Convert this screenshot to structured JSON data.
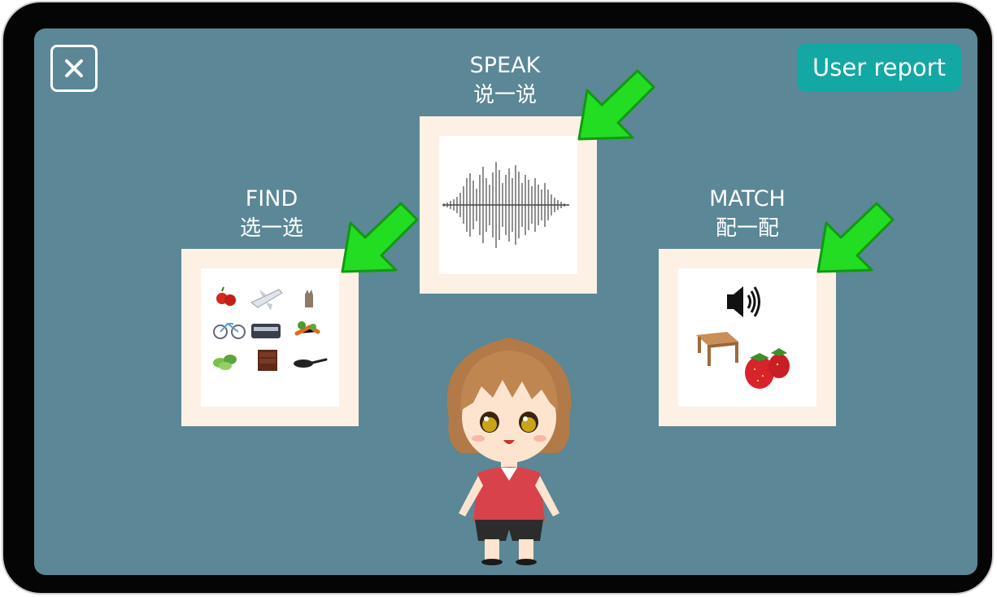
{
  "header": {
    "close_icon": "close-icon",
    "report_label": "User report"
  },
  "activities": [
    {
      "en": "FIND",
      "zh": "选一选",
      "icon": "picture-grid-icon"
    },
    {
      "en": "SPEAK",
      "zh": "说一说",
      "icon": "sound-wave-icon"
    },
    {
      "en": "MATCH",
      "zh": "配一配",
      "icon": "speaker-icon"
    }
  ],
  "colors": {
    "screen_bg": "#5b8796",
    "accent": "#13a8a3",
    "arrow": "#22dd22",
    "card_frame": "#fdf0e5"
  }
}
